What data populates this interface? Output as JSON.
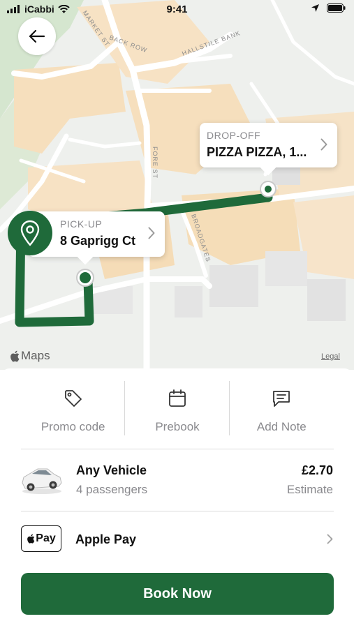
{
  "status_bar": {
    "carrier": "iCabbi",
    "time": "9:41"
  },
  "map": {
    "street_labels": [
      "MARKET ST",
      "BACK ROW",
      "HALLSTILE BANK",
      "FORE ST",
      "BROADGATES"
    ],
    "dropoff": {
      "label": "DROP-OFF",
      "address": "PIZZA PIZZA, 1..."
    },
    "pickup": {
      "label": "PICK-UP",
      "address": "8 Gaprigg Ct"
    },
    "maps_logo": "Maps",
    "legal": "Legal",
    "route_color": "#1f6a3a"
  },
  "options": [
    {
      "label": "Promo code",
      "icon": "tag-icon"
    },
    {
      "label": "Prebook",
      "icon": "calendar-icon"
    },
    {
      "label": "Add Note",
      "icon": "note-icon"
    }
  ],
  "vehicle": {
    "name": "Any Vehicle",
    "passengers": "4 passengers",
    "price": "£2.70",
    "estimate": "Estimate"
  },
  "payment": {
    "badge": "Pay",
    "label": "Apple Pay"
  },
  "book_button": {
    "label": "Book Now"
  },
  "colors": {
    "brand": "#1f6a3a",
    "muted_text": "#8a8a8e"
  }
}
